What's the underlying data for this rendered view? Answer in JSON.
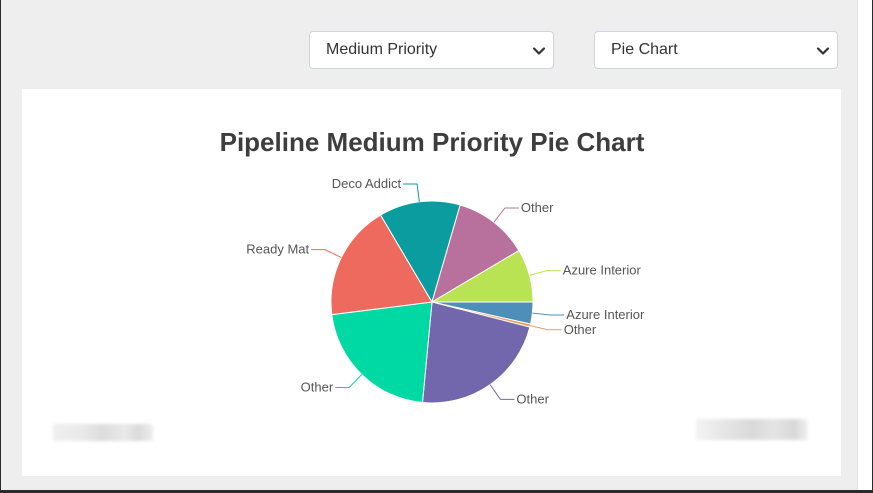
{
  "filters": {
    "priority": {
      "selected": "Medium Priority",
      "icon": "chevron-down-icon"
    },
    "chart_type": {
      "selected": "Pie Chart",
      "icon": "chevron-down-icon"
    }
  },
  "chart_data": {
    "type": "pie",
    "title": "Pipeline Medium Priority Pie Chart",
    "start_angle_deg": 90,
    "direction": "clockwise",
    "slices": [
      {
        "label": "Azure Interior",
        "value": 3.5,
        "color": "#4e8fba"
      },
      {
        "label": "Other",
        "value": 0.5,
        "color": "#ee9d56"
      },
      {
        "label": "Other",
        "value": 22.5,
        "color": "#7266ad"
      },
      {
        "label": "Other",
        "value": 21.5,
        "color": "#00d9a3"
      },
      {
        "label": "Ready Mat",
        "value": 18.5,
        "color": "#ee6a5e"
      },
      {
        "label": "Deco Addict",
        "value": 13,
        "color": "#0b9c9f"
      },
      {
        "label": "Other",
        "value": 12,
        "color": "#b8719c"
      },
      {
        "label": "Azure Interior",
        "value": 8.5,
        "color": "#b9e353"
      }
    ]
  }
}
